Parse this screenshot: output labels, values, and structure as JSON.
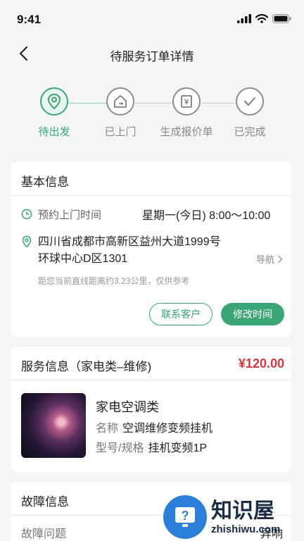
{
  "status": {
    "time": "9:41"
  },
  "nav": {
    "title": "待服务订单详情"
  },
  "steps": [
    {
      "label": "待出发",
      "icon": "location-pin-icon",
      "active": true
    },
    {
      "label": "已上门",
      "icon": "home-icon",
      "active": false
    },
    {
      "label": "生成报价单",
      "icon": "quote-document-icon",
      "active": false
    },
    {
      "label": "已完成",
      "icon": "checkmark-icon",
      "active": false
    }
  ],
  "basic": {
    "title": "基本信息",
    "time_label": "预约上门时间",
    "time_value": "星期一(今日) 8:00～10:00",
    "address_line1": "四川省成都市高新区益州大道1999号",
    "address_line2": "环球中心D区1301",
    "navigate": "导航",
    "distance_hint": "距您当前直线距离约3.23公里，仅供参考",
    "contact_button": "联系客户",
    "modify_button": "修改时间"
  },
  "service": {
    "title": "服务信息（家电类–维修)",
    "price": "¥120.00",
    "product_name": "家电空调类",
    "name_key": "名称",
    "name_value": "空调维修变频挂机",
    "model_key": "型号/规格",
    "model_value": "挂机变频1P"
  },
  "fault": {
    "title": "故障信息",
    "question_label": "故障问题",
    "question_value": "异响"
  },
  "watermark": {
    "brand": "知识屋",
    "site": "zhishiwu.com"
  },
  "colors": {
    "accent": "#3aa676",
    "price": "#d9363e"
  }
}
